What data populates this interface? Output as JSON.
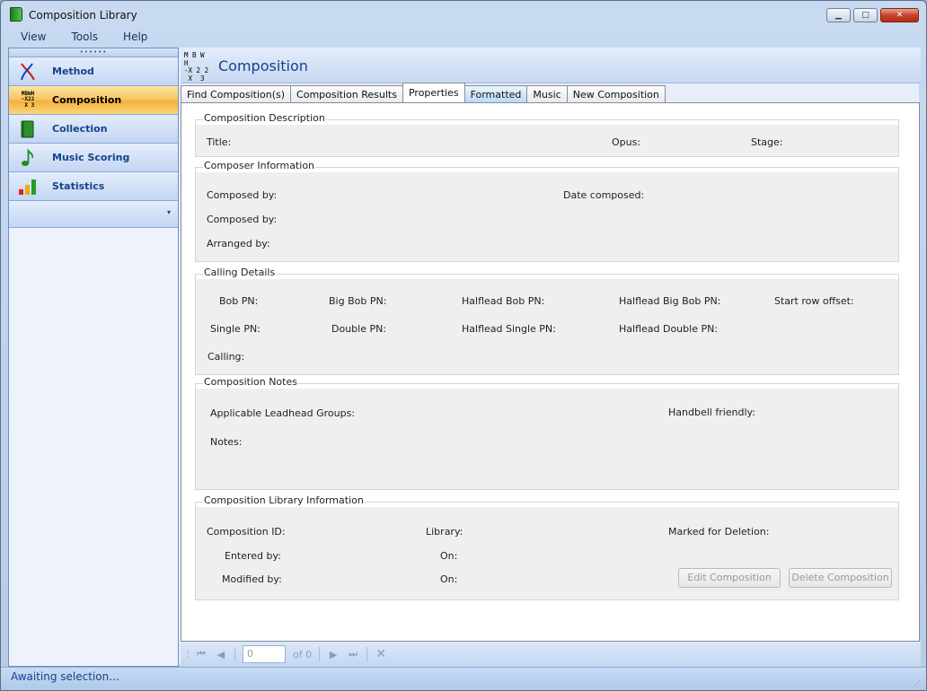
{
  "window": {
    "title": "Composition Library",
    "buttons": {
      "minimize": "▁",
      "maximize": "□",
      "close": "✕"
    }
  },
  "menu": [
    "View",
    "Tools",
    "Help"
  ],
  "nav": {
    "items": [
      {
        "label": "Method",
        "icon": "method-icon"
      },
      {
        "label": "Composition",
        "icon": "composition-icon"
      },
      {
        "label": "Collection",
        "icon": "collection-icon"
      },
      {
        "label": "Music Scoring",
        "icon": "music-note-icon"
      },
      {
        "label": "Statistics",
        "icon": "bar-chart-icon"
      }
    ],
    "active": "Composition"
  },
  "header": {
    "title": "Composition",
    "icon_text": [
      "M B W H",
      "-X 2 2",
      " X  3"
    ]
  },
  "tabs": [
    "Find Composition(s)",
    "Composition Results",
    "Properties",
    "Formatted",
    "Music",
    "New Composition"
  ],
  "active_tab": "Properties",
  "groups": {
    "description": {
      "title": "Composition Description",
      "title_label": "Title:",
      "opus_label": "Opus:",
      "stage_label": "Stage:"
    },
    "composer": {
      "title": "Composer Information",
      "composed_by_1": "Composed by:",
      "composed_by_2": "Composed by:",
      "arranged_by": "Arranged by:",
      "date_composed": "Date composed:"
    },
    "calling": {
      "title": "Calling Details",
      "bob_pn": "Bob PN:",
      "big_bob_pn": "Big Bob PN:",
      "halflead_bob_pn": "Halflead Bob PN:",
      "halflead_big_bob_pn": "Halflead Big Bob PN:",
      "start_row_offset": "Start row offset:",
      "single_pn": "Single PN:",
      "double_pn": "Double PN:",
      "halflead_single_pn": "Halflead Single PN:",
      "halflead_double_pn": "Halflead Double PN:",
      "calling": "Calling:"
    },
    "notes": {
      "title": "Composition Notes",
      "leadhead_groups": "Applicable Leadhead Groups:",
      "handbell_friendly": "Handbell friendly:",
      "notes": "Notes:"
    },
    "library": {
      "title": "Composition Library Information",
      "composition_id": "Composition ID:",
      "library": "Library:",
      "marked_for_deletion": "Marked for Deletion:",
      "entered_by": "Entered by:",
      "on_1": "On:",
      "modified_by": "Modified by:",
      "on_2": "On:",
      "edit_button": "Edit Composition",
      "delete_button": "Delete Composition"
    }
  },
  "navigator": {
    "position": "0",
    "count_text": "of 0"
  },
  "status": "Awaiting selection..."
}
